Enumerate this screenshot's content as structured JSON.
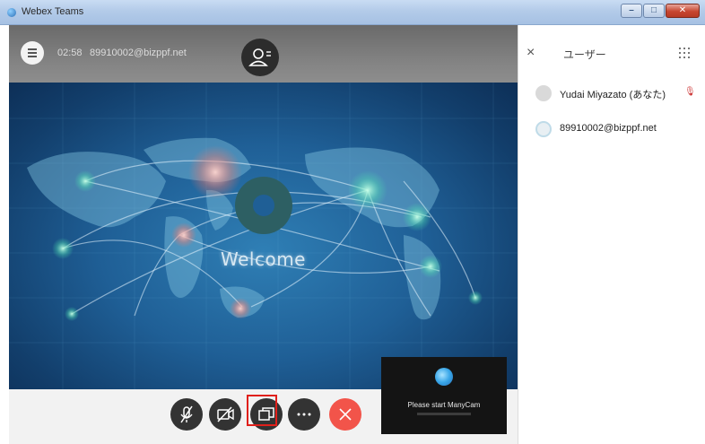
{
  "window": {
    "title": "Webex Teams",
    "buttons": {
      "minimize": "–",
      "maximize": "□",
      "close": "✕"
    }
  },
  "meeting": {
    "timer": "02:58",
    "host_email": "89910002@bizppf.net",
    "welcome_text": "Welcome"
  },
  "controls": {
    "icons": [
      "mic-off-icon",
      "camera-off-icon",
      "share-screen-icon",
      "more-icon",
      "end-call-icon"
    ],
    "more_label": "···",
    "highlight_color": "#e0201b",
    "end_color": "#f2544a"
  },
  "selfview": {
    "text": "Please start ManyCam"
  },
  "panel": {
    "close": "×",
    "title": "ユーザー",
    "users": [
      {
        "name": "Yudai Miyazato (あなた)"
      },
      {
        "name": "89910002@bizppf.net"
      }
    ]
  }
}
